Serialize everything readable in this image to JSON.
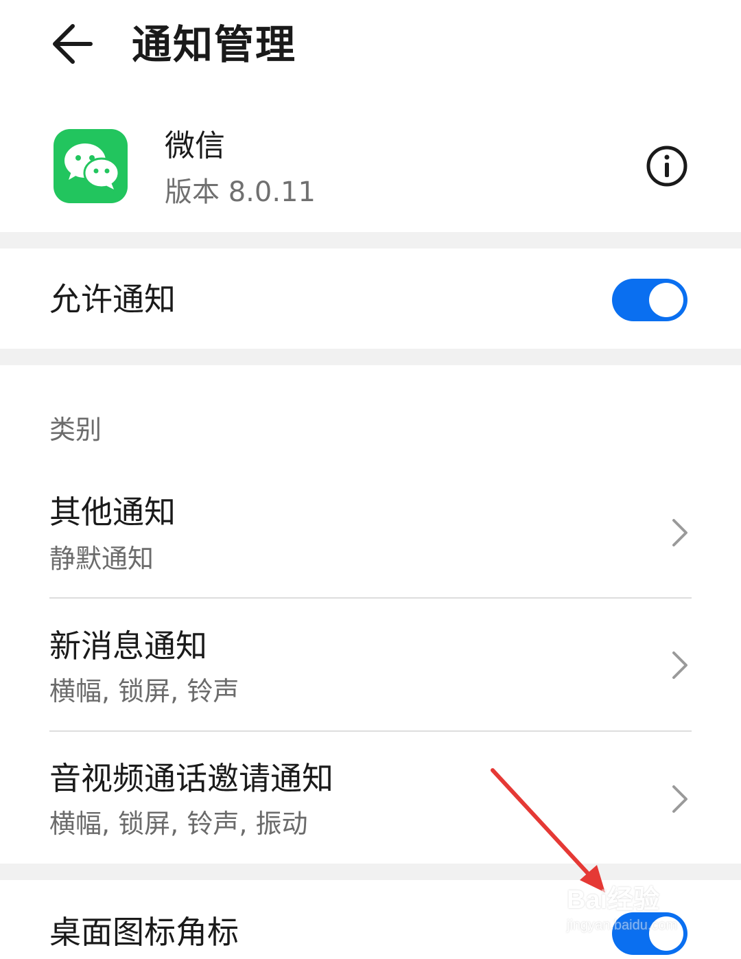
{
  "header": {
    "title": "通知管理",
    "back_icon": "arrow-left-icon"
  },
  "app": {
    "name": "微信",
    "version": "版本 8.0.11",
    "icon": "wechat-logo-icon",
    "icon_color": "#22c55e",
    "info_icon": "info-circle-icon"
  },
  "allow_notifications": {
    "label": "允许通知",
    "enabled": true
  },
  "categories": {
    "header": "类别",
    "items": [
      {
        "title": "其他通知",
        "subtitle": "静默通知"
      },
      {
        "title": "新消息通知",
        "subtitle": "横幅, 锁屏, 铃声"
      },
      {
        "title": "音视频通话邀请通知",
        "subtitle": "横幅, 锁屏, 铃声, 振动"
      }
    ]
  },
  "badge": {
    "label": "桌面图标角标",
    "enabled": true
  },
  "annotation": {
    "arrow_color": "#e53935",
    "arrow_icon": "red-arrow-annotation"
  },
  "watermark": {
    "text": "Bai经验",
    "url_text": "jingyan.baidu.com"
  },
  "colors": {
    "accent": "#0a6ff0",
    "section_gap": "#f1f1f1",
    "secondary_text": "#6b6b6b"
  }
}
